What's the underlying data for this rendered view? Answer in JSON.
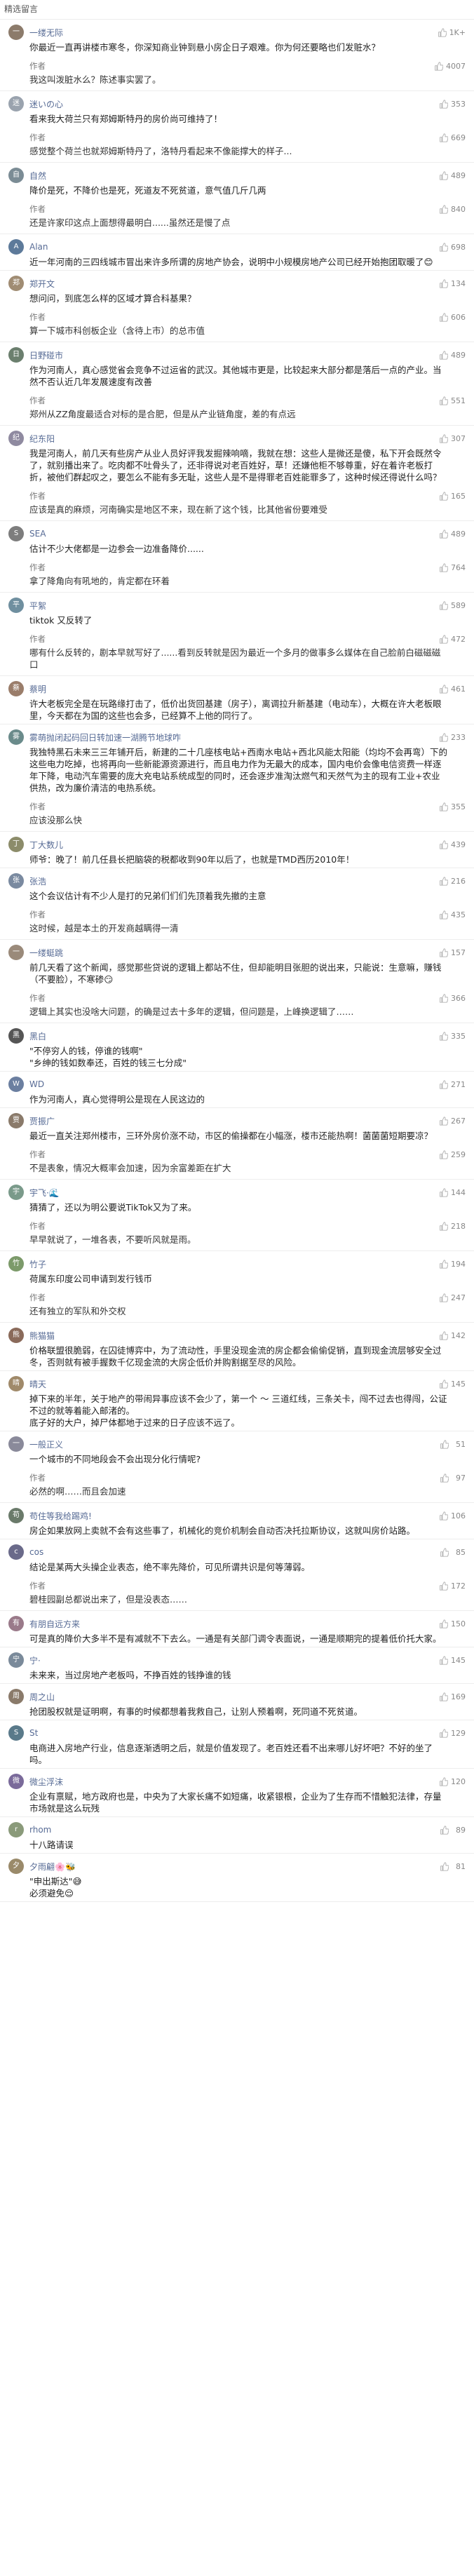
{
  "section_title": "精选留言",
  "colors": {
    "name": "#576b95",
    "like": "#b2b2b2",
    "text": "#222222"
  },
  "icons": {
    "like": "thumbs-up-icon"
  },
  "comments": [
    {
      "avatar_text": "一",
      "avatar_color": "#8c7b6b",
      "name": "一缕无际",
      "likes": "1K+",
      "text": "你最近一直再讲楼市寒冬，你深知商业钟到悬小房企日子艰难。你为何还要略也们发赃水？",
      "reply": {
        "author": "作者",
        "likes": "4007",
        "text": "我这叫泼脏水么？陈述事实罢了。"
      }
    },
    {
      "avatar_text": "迷",
      "avatar_color": "#9aa3ae",
      "name": "迷いの心",
      "likes": "353",
      "text": "看来我大荷兰只有郑姆斯特丹的房价尚可维持了！",
      "reply": {
        "author": "作者",
        "likes": "669",
        "text": "感觉整个荷兰也就郑姆斯特丹了，洛特丹看起来不像能撑大的样子..."
      }
    },
    {
      "avatar_text": "自",
      "avatar_color": "#7b8c95",
      "name": "自然",
      "likes": "489",
      "text": "降价是死，不降价也是死，死道友不死贫道，意气值几斤几两",
      "reply": {
        "author": "作者",
        "likes": "840",
        "text": "还是许家印这点上面想得最明白......虽然还是慢了点"
      }
    },
    {
      "avatar_text": "A",
      "avatar_color": "#5d7a9a",
      "name": "Alan",
      "likes": "698",
      "text": "近一年河南的三四线城市冒出来许多所谓的房地产协会，说明中小规模房地产公司已经开始抱团取暖了😊",
      "reply": null
    },
    {
      "avatar_text": "郑",
      "avatar_color": "#a08c73",
      "name": "郑开文",
      "likes": "134",
      "text": "想问问，到底怎么样的区域才算合科基果？",
      "reply": {
        "author": "作者",
        "likes": "606",
        "text": "算一下城市科创板企业（含待上市）的总市值"
      }
    },
    {
      "avatar_text": "日",
      "avatar_color": "#6b7f6e",
      "name": "日野碰市",
      "likes": "489",
      "text": "作为河南人，真心感觉省会竞争不过运省的武汉。其他城市更是，比较起来大部分都是落后一点的产业。当然不否认近几年发展速度有改善",
      "reply": {
        "author": "作者",
        "likes": "551",
        "text": "郑州从ZZ角度最适合对标的是合肥，但是从产业链角度，差的有点远"
      }
    },
    {
      "avatar_text": "纪",
      "avatar_color": "#8f8aa0",
      "name": "纪东阳",
      "likes": "307",
      "text": "我是河南人，前几天有些房产从业人员好评我发掘辣响嘀，我就在想：这些人是微还是傻，私下开会既然令了，就别播出来了。吃肉都不吐骨头了，还非得说对老百姓好，草！还嫌他柜不够尊重，好在着许老板打折，被他们群起叹之，要怎么不能有多无耻，这些人是不是得罪老百姓能罪多了，这种时候还得说什么吗？",
      "reply": {
        "author": "作者",
        "likes": "165",
        "text": "应该是真的麻烦，河南确实是地区不来，现在新了这个钱，比其他省份要难受"
      }
    },
    {
      "avatar_text": "S",
      "avatar_color": "#7d7d7d",
      "name": "SEA",
      "likes": "489",
      "text": "估计不少大佬都是一边参会一边准备降价......",
      "reply": {
        "author": "作者",
        "likes": "764",
        "text": "拿了降角向有吼地的，肯定都在环着"
      }
    },
    {
      "avatar_text": "平",
      "avatar_color": "#6f8f9f",
      "name": "平絮",
      "likes": "589",
      "text": "tiktok 又反转了",
      "reply": {
        "author": "作者",
        "likes": "472",
        "text": "哪有什么反转的，剧本早就写好了......看到反转就是因为最近一个多月的做事多么媒体在自己脸前白磁磁磁口"
      }
    },
    {
      "avatar_text": "蔡",
      "avatar_color": "#9a7d6a",
      "name": "蔡明",
      "likes": "461",
      "text": "许大老板完全是在玩路缘打击了，低价出货回基建（房子），离调拉升新基建（电动车），大概在许大老板眼里，今天都在为国的这些也会多，已经算不上他的同行了。",
      "reply": null
    },
    {
      "avatar_text": "雾",
      "avatar_color": "#6a8b8b",
      "name": "雾萌抛闭起码回日转加速一湖腾节地球咋",
      "likes": "233",
      "text": "我独特黑石未来三三年铺开后，新建的二十几座核电站+西南水电站+西北风能太阳能（均均不会再弯）下的这些电力吃掉，也将再向一些新能源资源进行，而且电力作为无最大的成本，国内电价会像电信资费一样逐年下降，电动汽车需要的庞大充电站系统成型的同时，还会逐步准淘汰燃气和天然气为主的现有工业+农业供热，改为廉价清洁的电热系统。",
      "reply": {
        "author": "作者",
        "likes": "355",
        "text": "应该没那么快"
      }
    },
    {
      "avatar_text": "丁",
      "avatar_color": "#8c8c6a",
      "name": "丁大数儿",
      "likes": "439",
      "text": "师爷：晚了！前几任县长把脑袋的税都收到90年以后了，也就是TMD西历2010年！",
      "reply": null
    },
    {
      "avatar_text": "张",
      "avatar_color": "#7a8aa0",
      "name": "张浩",
      "likes": "216",
      "text": "这个会议估计有不少人是打的兄弟们们们先顶着我先撤的主意",
      "reply": {
        "author": "作者",
        "likes": "435",
        "text": "这时候，越是本土的开发商越瞒得一清"
      }
    },
    {
      "avatar_text": "一",
      "avatar_color": "#9a8a7a",
      "name": "一缕蜓跳",
      "likes": "157",
      "text": "前几天看了这个新闻，感觉那些贷说的逻辑上都站不住，但却能明目张胆的说出来，只能说：生意嘛，赚钱（不要脸），不寒碜😏",
      "reply": {
        "author": "作者",
        "likes": "366",
        "text": "逻辑上其实也没啥大问题，的确是过去十多年的逻辑，但问题是，上峰换逻辑了……"
      }
    },
    {
      "avatar_text": "黑",
      "avatar_color": "#555555",
      "name": "黑白",
      "likes": "335",
      "text": "\"不停穷人的钱，停谁的钱啊\"\n\"乡绅的钱如数奉还，百姓的钱三七分成\"",
      "reply": null
    },
    {
      "avatar_text": "W",
      "avatar_color": "#6b7fa0",
      "name": "WD",
      "likes": "271",
      "text": "作为河南人，真心觉得明公是现在人民这边的",
      "reply": null
    },
    {
      "avatar_text": "贾",
      "avatar_color": "#8a7a6a",
      "name": "贾振广",
      "likes": "267",
      "text": "最近一直关注郑州楼市，三环外房价涨不动，市区的偷操都在小幅涨，楼市还能热啊！菌菌菌短期要凉？",
      "reply": {
        "author": "作者",
        "likes": "259",
        "text": "不是表象，情况大概率会加速，因为余富差距在扩大"
      }
    },
    {
      "avatar_text": "宇",
      "avatar_color": "#7a9a8a",
      "name": "宇飞·🌊",
      "likes": "144",
      "text": "猜猜了，还以为明公要说TikTok又为了来。",
      "reply": {
        "author": "作者",
        "likes": "218",
        "text": "早早就说了，一堆各表，不要听风就是雨。"
      }
    },
    {
      "avatar_text": "竹",
      "avatar_color": "#7c9a6a",
      "name": "竹子",
      "likes": "194",
      "text": "荷属东印度公司申请到发行钱币",
      "reply": {
        "author": "作者",
        "likes": "247",
        "text": "还有独立的军队和外交权"
      }
    },
    {
      "avatar_text": "熊",
      "avatar_color": "#8a6a5a",
      "name": "熊猫猫",
      "likes": "142",
      "text": "价格联盟很脆弱，在囚徒博弈中，为了流动性，手里没现金流的房企都会偷偷促销，直到现金流层够安全过冬，否则就有被手握数千亿现金流的大房企低价并购割据至尽的风险。",
      "reply": null
    },
    {
      "avatar_text": "晴",
      "avatar_color": "#a08a6a",
      "name": "晴天",
      "likes": "145",
      "text": "掉下来的半年，关于地产的带闹异事应该不会少了，第一个 ～ 三道红线，三条关卡，闯不过去也得闯，公证不过的就等着能入邮渚的。\n底子好的大户，掉尸体都地于过来的日子应该不远了。",
      "reply": null
    },
    {
      "avatar_text": "一",
      "avatar_color": "#8a8a9a",
      "name": "一般正义",
      "likes": "51",
      "text": "一个城市的不同地段会不会出现分化行情呢?",
      "reply": {
        "author": "作者",
        "likes": "97",
        "text": "必然的啊……而且会加速"
      }
    },
    {
      "avatar_text": "苟",
      "avatar_color": "#6a7a6a",
      "name": "苟住等我给踢鸡!",
      "likes": "106",
      "text": "房企如果放网上卖就不会有这些事了，机械化的竞价机制会自动否决托拉斯协议，这就叫房价站路。",
      "reply": null
    },
    {
      "avatar_text": "c",
      "avatar_color": "#6a6a8a",
      "name": "cos",
      "likes": "85",
      "text": "结论是某两大头操企业表态，绝不率先降价，可见所谓共识是何等薄弱。",
      "reply": {
        "author": "作者",
        "likes": "172",
        "text": "碧桂园副总都说出来了，但是没表态……"
      }
    },
    {
      "avatar_text": "有",
      "avatar_color": "#9a7a8a",
      "name": "有朋自远方来",
      "likes": "150",
      "text": "可是真的降价大多半不是有减就不下去么。一通是有关部门调令表面说，一通是顺期完的提着低价托大家。",
      "reply": null
    },
    {
      "avatar_text": "宁",
      "avatar_color": "#7a8a9a",
      "name": "宁·",
      "likes": "145",
      "text": "未来来，当过房地产老板吗，不挣百姓的钱挣谁的钱",
      "reply": null
    },
    {
      "avatar_text": "周",
      "avatar_color": "#8a7a6a",
      "name": "周之山",
      "likes": "169",
      "text": "抢团股权就是证明啊，有事的时候都想着我救自己，让别人预着啊，死同道不死贫道。",
      "reply": null
    },
    {
      "avatar_text": "S",
      "avatar_color": "#5a7a8a",
      "name": "St",
      "likes": "129",
      "text": "电商进入房地产行业，信息逐渐透明之后，就是价值发现了。老百姓还看不出来哪儿好坏吧？不好的坐了吗。",
      "reply": null
    },
    {
      "avatar_text": "微",
      "avatar_color": "#7a6a9a",
      "name": "微尘浮沫",
      "likes": "120",
      "text": "企业有禀赋，地方政府也是，中央为了大家长痛不如短痛，收紧银根，企业为了生存而不惜触犯法律，存量市场就是这么玩残",
      "reply": null
    },
    {
      "avatar_text": "r",
      "avatar_color": "#8a9a7a",
      "name": "rhom",
      "likes": "89",
      "text": "十八路请误",
      "reply": null
    },
    {
      "avatar_text": "夕",
      "avatar_color": "#9a8a6a",
      "name": "夕雨翩🌸🐝",
      "likes": "81",
      "text": "\"申出斯达\"😅\n必须避免😌",
      "reply": null
    }
  ]
}
